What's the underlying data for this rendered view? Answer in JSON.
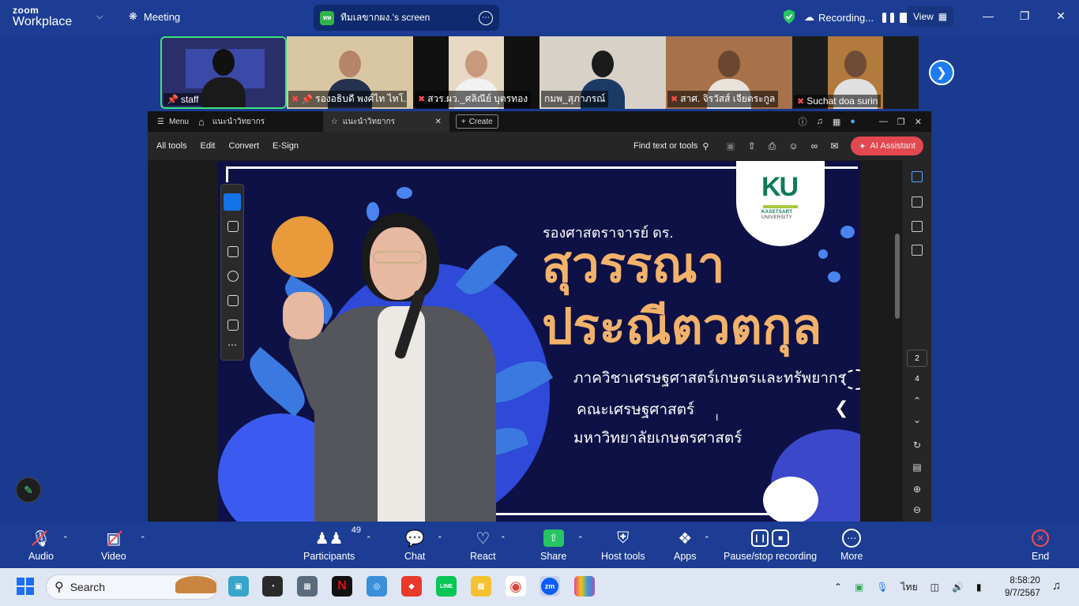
{
  "topbar": {
    "logo_line1": "zoom",
    "logo_line2": "Workplace",
    "meeting_label": "Meeting",
    "screen_badge": "ทห",
    "screen_label": "ทีมเลขากผง.'s screen",
    "recording_label": "Recording...",
    "view_label": "View"
  },
  "gallery": [
    {
      "name": "staff",
      "muted": false,
      "pinned": true
    },
    {
      "name": "รองอธิบดี พงศ์ไท ไทโ...",
      "muted": true,
      "pinned": true
    },
    {
      "name": "สวร.ผว._ศลิณีย์ บุตรทอง",
      "muted": true,
      "pinned": false
    },
    {
      "name": "กมพ_สุภาภรณ์",
      "muted": false,
      "pinned": false
    },
    {
      "name": "สาศ. จิรวัสส์ เจียตระกูล",
      "muted": true,
      "pinned": false
    },
    {
      "name": "Suchat doa surin",
      "muted": true,
      "pinned": false
    }
  ],
  "acrobat": {
    "menu_label": "Menu",
    "tab1_label": "แนะนำวิทยากร",
    "tab2_label": "แนะนำวิทยากร",
    "create_label": "Create",
    "tools": [
      "All tools",
      "Edit",
      "Convert",
      "E-Sign"
    ],
    "find_label": "Find text or tools",
    "ai_label": "AI Assistant",
    "page_current": "2",
    "page_total": "4"
  },
  "slide": {
    "title_small": "รองศาสตราจารย์ ดร.",
    "name_line1": "สุวรรณา",
    "name_line2": "ประณีตวตกุล",
    "line1": "ภาควิชาเศรษฐศาสตร์เกษตรและทรัพยากร",
    "line2": "คณะเศรษฐศาสตร์",
    "line3": "มหาวิทยาลัยเกษตรศาสตร์",
    "logo_text": "KU",
    "logo_sub1": "KASETSART",
    "logo_sub2": "UNIVERSITY"
  },
  "controls": {
    "audio": "Audio",
    "video": "Video",
    "participants": "Participants",
    "participants_count": "49",
    "chat": "Chat",
    "react": "React",
    "share": "Share",
    "host_tools": "Host tools",
    "apps": "Apps",
    "pause_recording": "Pause/stop recording",
    "more": "More",
    "end": "End"
  },
  "taskbar": {
    "search_placeholder": "Search",
    "language": "ไทย",
    "time": "8:58:20",
    "date": "9/7/2567"
  },
  "colors": {
    "zoom_blue": "#1c3d93",
    "slide_bg": "#0e1145",
    "name_orange": "#f2b26b",
    "active_green": "#3ee37a",
    "ai_red": "#e34850"
  }
}
